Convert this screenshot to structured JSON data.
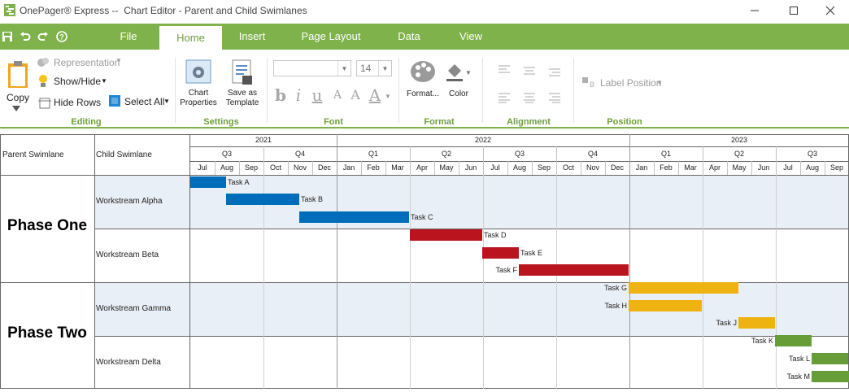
{
  "window": {
    "title": "OnePager® Express --  Chart Editor - Parent and Child Swimlanes"
  },
  "tabs": [
    {
      "label": "File"
    },
    {
      "label": "Home"
    },
    {
      "label": "Insert"
    },
    {
      "label": "Page Layout"
    },
    {
      "label": "Data"
    },
    {
      "label": "View"
    }
  ],
  "ribbon": {
    "editing": {
      "copy": "Copy",
      "representation": "Representation",
      "show_hide": "Show/Hide",
      "hide_rows": "Hide Rows",
      "select_all": "Select All",
      "label": "Editing"
    },
    "settings": {
      "chart_properties": "Chart Properties",
      "save_as_template": "Save as Template",
      "label": "Settings"
    },
    "font": {
      "font_name": "",
      "font_size": "14",
      "label": "Font"
    },
    "format": {
      "format_button": "Format...",
      "color_button": "Color",
      "label": "Format"
    },
    "alignment": {
      "label": "Alignment"
    },
    "position": {
      "label_position": "Label Position",
      "label": "Position"
    }
  },
  "grid": {
    "parent_header": "Parent Swimlane",
    "child_header": "Child Swimlane",
    "years": [
      "2021",
      "2022",
      "2023"
    ],
    "quarters": [
      "Q3",
      "Q4",
      "Q1",
      "Q2",
      "Q3",
      "Q4",
      "Q1",
      "Q2",
      "Q3"
    ],
    "months": [
      "Jul",
      "Aug",
      "Sep",
      "Oct",
      "Nov",
      "Dec",
      "Jan",
      "Feb",
      "Mar",
      "Apr",
      "May",
      "Jun",
      "Jul",
      "Aug",
      "Sep",
      "Oct",
      "Nov",
      "Dec",
      "Jan",
      "Feb",
      "Mar",
      "Apr",
      "May",
      "Jun",
      "Jul",
      "Aug",
      "Sep"
    ],
    "parents": [
      "Phase One",
      "Phase Two"
    ],
    "children": [
      "Workstream Alpha",
      "Workstream Beta",
      "Workstream Gamma",
      "Workstream Delta"
    ],
    "tasks": [
      {
        "name": "Task A",
        "start": "2021-07-01",
        "end": "2021-08-15",
        "color": "#0070c0",
        "label_side": "right"
      },
      {
        "name": "Task B",
        "start": "2021-08-15",
        "end": "2021-11-15",
        "color": "#0070c0",
        "label_side": "right"
      },
      {
        "name": "Task C",
        "start": "2021-11-15",
        "end": "2022-03-31",
        "color": "#0070c0",
        "label_side": "right"
      },
      {
        "name": "Task D",
        "start": "2022-04-01",
        "end": "2022-06-30",
        "color": "#c0161f",
        "label_side": "right"
      },
      {
        "name": "Task E",
        "start": "2022-06-30",
        "end": "2022-08-15",
        "color": "#c0161f",
        "label_side": "right"
      },
      {
        "name": "Task F",
        "start": "2022-08-15",
        "end": "2022-12-31",
        "color": "#c0161f",
        "label_side": "left"
      },
      {
        "name": "Task G",
        "start": "2022-12-31",
        "end": "2023-05-15",
        "color": "#f5b911",
        "label_side": "left"
      },
      {
        "name": "Task H",
        "start": "2022-12-31",
        "end": "2023-03-31",
        "color": "#f5b911",
        "label_side": "left"
      },
      {
        "name": "Task J",
        "start": "2023-05-15",
        "end": "2023-06-30",
        "color": "#f5b911",
        "label_side": "left"
      },
      {
        "name": "Task K",
        "start": "2023-06-30",
        "end": "2023-08-15",
        "color": "#6aa23a",
        "label_side": "left"
      },
      {
        "name": "Task L",
        "start": "2023-08-15",
        "end": "2023-09-30",
        "color": "#6aa23a",
        "label_side": "left"
      },
      {
        "name": "Task M",
        "start": "2023-08-15",
        "end": "2023-11-15",
        "color": "#6aa23a",
        "label_side": "left"
      }
    ]
  },
  "colors": {
    "accent": "#7fb24a",
    "band_fill": "#e9eff6"
  }
}
